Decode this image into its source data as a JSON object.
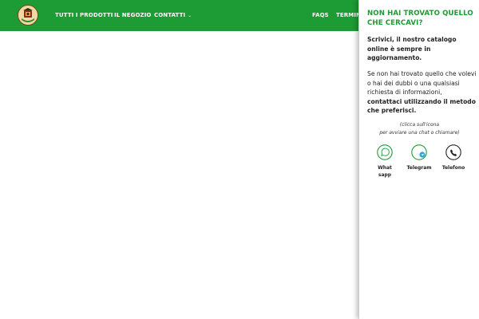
{
  "nav": {
    "items": [
      {
        "label": "TUTTI I PRODOTTI",
        "has_dropdown": true
      },
      {
        "label": "IL NEGOZIO",
        "has_dropdown": false
      },
      {
        "label": "CONTATTI",
        "has_dropdown": true
      },
      {
        "label": "FAQS",
        "has_dropdown": false
      },
      {
        "label": "TERMINI",
        "has_dropdown": false
      }
    ],
    "dropdown_glyph": "⌄",
    "logo_icon": "shop-logo-icon"
  },
  "panel": {
    "title": "NON HAI TROVATO QUELLO CHE CERCAVI?",
    "intro": "Scrivici, il nostro catalogo online è sempre in aggiornamento.",
    "body_plain": "Se non hai trovato quello che volevi o hai dei dubbi o una qualsiasi richiesta di informazioni, ",
    "body_bold": "contattaci utilizzando il metodo che preferisci.",
    "hint_line1": "(clicca sull'icona",
    "hint_line2": "per avviare una chat o chiamare)",
    "contacts": [
      {
        "label": "Whatsapp",
        "icon": "whatsapp-icon"
      },
      {
        "label": "Telegram",
        "icon": "telegram-icon"
      },
      {
        "label": "Telefono",
        "icon": "phone-icon"
      }
    ]
  },
  "colors": {
    "brand_green": "#1d9b34",
    "text_dark": "#222222",
    "telegram_blue": "#2aa3dc"
  }
}
